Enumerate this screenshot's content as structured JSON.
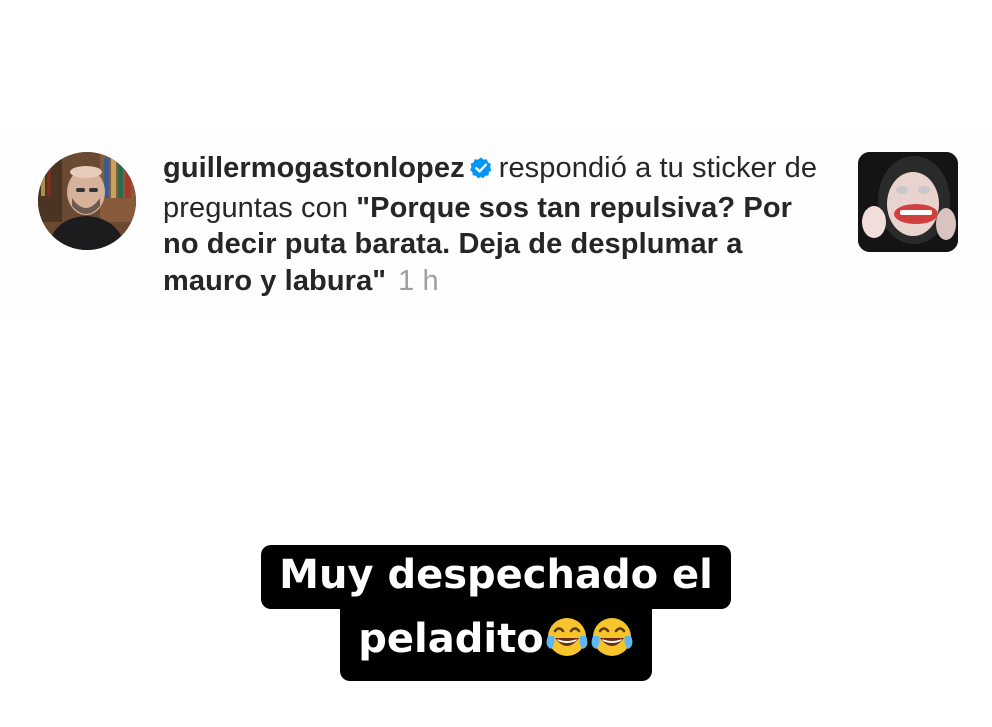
{
  "notification": {
    "username": "guillermogastonlopez",
    "action_text": "respondió a tu sticker de preguntas con",
    "reply_text": "\"Porque sos tan repulsiva? Por no decir puta barata. Deja de desplumar a mauro y labura\"",
    "timestamp": "1 h",
    "verified": true,
    "avatar_icon": "profile-photo",
    "thumbnail_icon": "story-thumbnail",
    "verified_color": "#0095f6"
  },
  "caption": {
    "line1": "Muy despechado el",
    "line2": "peladito",
    "emoji": "face-with-tears-of-joy-icon"
  }
}
